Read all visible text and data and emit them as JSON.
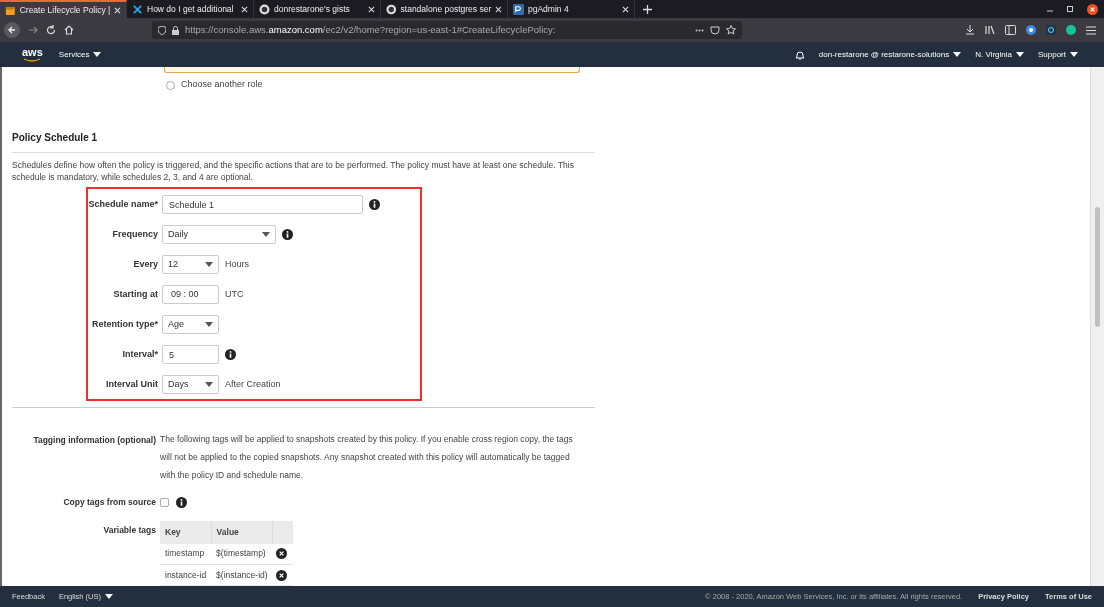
{
  "browser": {
    "tabs": [
      {
        "title": "Create Lifecycle Policy |",
        "selected": true
      },
      {
        "title": "How do I get additional",
        "selected": false
      },
      {
        "title": "donrestarone's gists",
        "selected": false
      },
      {
        "title": "standalone postgres ser",
        "selected": false
      },
      {
        "title": "pgAdmin 4",
        "selected": false
      }
    ],
    "url_host": "console.aws.",
    "url_domain": "amazon.com",
    "url_path": "/ec2/v2/home?region=us-east-1#CreateLifecyclePolicy:",
    "url_scheme": "https://"
  },
  "nav": {
    "logo": "aws",
    "services": "Services",
    "account": "don-restarone @ restarone-solutions",
    "region": "N. Virginia",
    "support": "Support"
  },
  "role_option": {
    "label": "Choose another role",
    "selected": false
  },
  "section": {
    "title": "Policy Schedule 1",
    "description": "Schedules define how often the policy is triggered, and the specific actions that are to be performed. The policy must have at least one schedule. This schedule is mandatory, while schedules 2, 3, and 4 are optional."
  },
  "schedule_fields": [
    {
      "label": "Schedule name*",
      "kind": "text",
      "value": "Schedule 1",
      "info": true
    },
    {
      "label": "Frequency",
      "kind": "select",
      "value": "Daily",
      "info": true
    },
    {
      "label": "Every",
      "kind": "select",
      "value": "12",
      "info": false,
      "suffix": "Hours"
    },
    {
      "label": "Starting at",
      "kind": "time",
      "value": "09 : 00",
      "info": false,
      "suffix": "UTC"
    },
    {
      "label": "Retention type*",
      "kind": "select",
      "value": "Age",
      "info": false
    },
    {
      "label": "Interval*",
      "kind": "text",
      "value": "5",
      "info": true
    },
    {
      "label": "Interval Unit",
      "kind": "select",
      "value": "Days",
      "info": false,
      "suffix": "After Creation"
    }
  ],
  "tagging": {
    "label": "Tagging information (optional)",
    "text": "The following tags will be applied to snapshots created by this policy. If you enable cross region copy, the tags will not be applied to the copied snapshots. Any snapshot created with this policy will automatically be tagged with the policy ID and schedule name."
  },
  "copy_tags": {
    "label": "Copy tags from source",
    "checked": false
  },
  "variable_tags": {
    "label": "Variable tags",
    "columns": [
      "Key",
      "Value"
    ],
    "rows": [
      {
        "key": "timestamp",
        "value": "$(timestamp)"
      },
      {
        "key": "instance-id",
        "value": "$(instance-id)"
      }
    ]
  },
  "footer": {
    "feedback": "Feedback",
    "language": "English (US)",
    "copyright": "© 2008 - 2020, Amazon Web Services, Inc. or its affiliates. All rights reserved.",
    "links": [
      "Privacy Policy",
      "Terms of Use"
    ]
  }
}
